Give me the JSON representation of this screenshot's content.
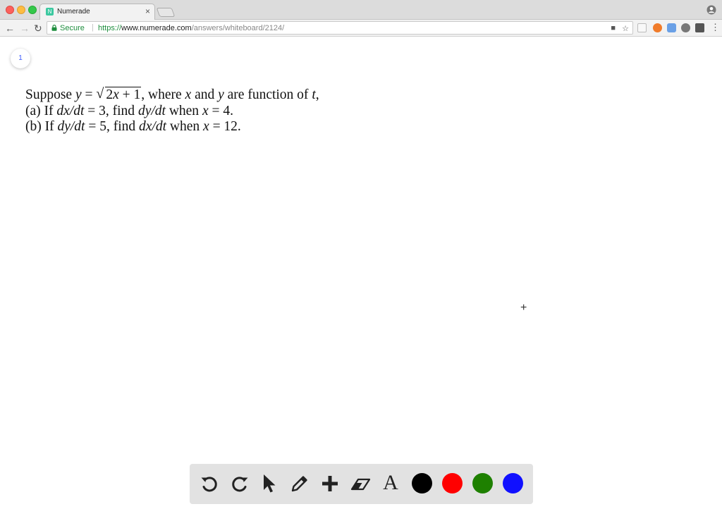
{
  "browser": {
    "tab": {
      "title": "Numerade",
      "favicon_letter": "N",
      "close": "×"
    },
    "address": {
      "secure_label": "Secure",
      "scheme": "https://",
      "host": "www.numerade.com",
      "path": "/answers/whiteboard/2124/"
    }
  },
  "whiteboard": {
    "page_number": "1",
    "problem": {
      "line1": {
        "t1": "Suppose ",
        "v_y": "y",
        "t2": " = ",
        "radicand_a": "2",
        "radicand_x": "x",
        "radicand_b": " + 1",
        "t3": ", where ",
        "v_x": "x",
        "t4": " and ",
        "v_y2": "y",
        "t5": " are function of ",
        "v_t": "t",
        "t6": ","
      },
      "line2": {
        "t1": "(a) If ",
        "d1": "dx/dt",
        "t2": " = 3, find ",
        "d2": "dy/dt",
        "t3": " when ",
        "v": "x",
        "t4": " = 4."
      },
      "line3": {
        "t1": "(b) If ",
        "d1": "dy/dt",
        "t2": " = 5, find ",
        "d2": "dx/dt",
        "t3": " when ",
        "v": "x",
        "t4": " = 12."
      }
    },
    "cursor": "+",
    "text_tool_label": "A",
    "tools": [
      "undo",
      "redo",
      "select",
      "pen",
      "add",
      "eraser",
      "text"
    ],
    "colors": [
      "#000000",
      "#ff0000",
      "#1e8000",
      "#1010ff"
    ]
  }
}
